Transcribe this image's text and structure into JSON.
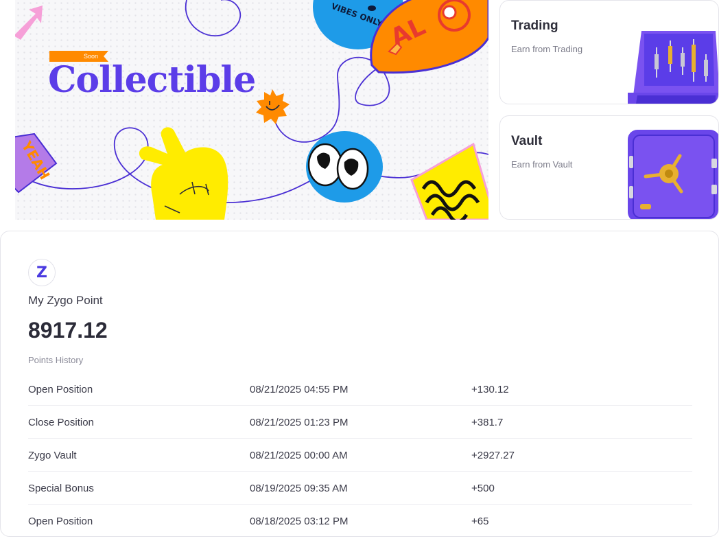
{
  "banner": {
    "badge": "Soon",
    "title": "Collectible",
    "sticker_top": "VIBES ONLY",
    "sticker_yeah": "YEAH",
    "sticker_orange": "AL"
  },
  "cards": [
    {
      "title": "Trading",
      "subtitle": "Earn from Trading",
      "icon": "trading-chart-icon"
    },
    {
      "title": "Vault",
      "subtitle": "Earn from Vault",
      "icon": "vault-safe-icon"
    }
  ],
  "points": {
    "logo_letter": "Z",
    "label": "My Zygo Point",
    "value": "8917.12",
    "history_label": "Points History",
    "history": [
      {
        "type": "Open Position",
        "date": "08/21/2025 04:55 PM",
        "amount": "+130.12"
      },
      {
        "type": "Close Position",
        "date": "08/21/2025 01:23 PM",
        "amount": "+381.7"
      },
      {
        "type": "Zygo Vault",
        "date": "08/21/2025 00:00 AM",
        "amount": "+2927.27"
      },
      {
        "type": "Special Bonus",
        "date": "08/19/2025 09:35 AM",
        "amount": "+500"
      },
      {
        "type": "Open Position",
        "date": "08/18/2025 03:12 PM",
        "amount": "+65"
      }
    ]
  },
  "colors": {
    "brand": "#5b3de8",
    "accent": "#ff8a00"
  }
}
